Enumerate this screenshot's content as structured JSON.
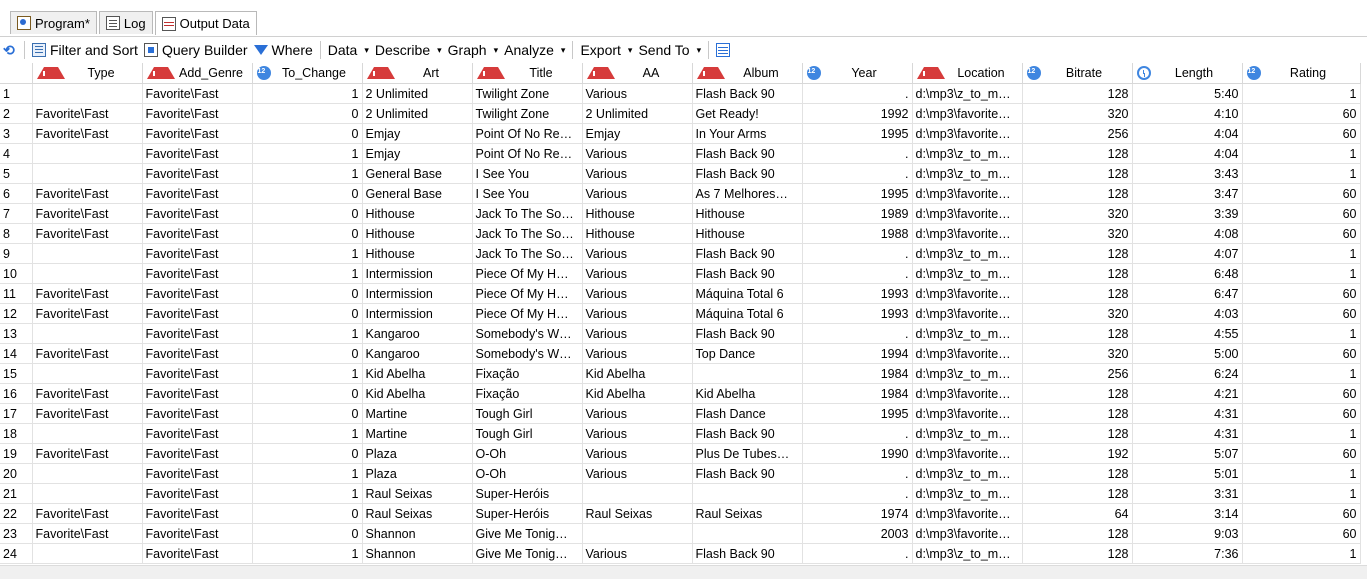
{
  "tabs": [
    {
      "label": "Program*",
      "icon": "program-icon"
    },
    {
      "label": "Log",
      "icon": "log-icon"
    },
    {
      "label": "Output Data",
      "icon": "output-data-icon"
    }
  ],
  "toolbar": {
    "filter_sort": "Filter and Sort",
    "query_builder": "Query Builder",
    "where": "Where",
    "data": "Data",
    "describe": "Describe",
    "graph": "Graph",
    "analyze": "Analyze",
    "export": "Export",
    "send_to": "Send To"
  },
  "columns": [
    {
      "name": "Type",
      "kind": "char"
    },
    {
      "name": "Add_Genre",
      "kind": "char"
    },
    {
      "name": "To_Change",
      "kind": "numeric"
    },
    {
      "name": "Art",
      "kind": "char"
    },
    {
      "name": "Title",
      "kind": "char"
    },
    {
      "name": "AA",
      "kind": "char"
    },
    {
      "name": "Album",
      "kind": "char"
    },
    {
      "name": "Year",
      "kind": "numeric"
    },
    {
      "name": "Location",
      "kind": "char"
    },
    {
      "name": "Bitrate",
      "kind": "numeric"
    },
    {
      "name": "Length",
      "kind": "time"
    },
    {
      "name": "Rating",
      "kind": "numeric"
    }
  ],
  "rows": [
    [
      "1",
      "",
      "Favorite\\Fast",
      "1",
      "2 Unlimited",
      "Twilight Zone",
      "Various",
      "Flash Back 90",
      ".",
      "d:\\mp3\\z_to_m…",
      "128",
      "5:40",
      "1"
    ],
    [
      "2",
      "Favorite\\Fast",
      "Favorite\\Fast",
      "0",
      "2 Unlimited",
      "Twilight Zone",
      "2 Unlimited",
      "Get Ready!",
      "1992",
      "d:\\mp3\\favorite…",
      "320",
      "4:10",
      "60"
    ],
    [
      "3",
      "Favorite\\Fast",
      "Favorite\\Fast",
      "0",
      "Emjay",
      "Point Of No Re…",
      "Emjay",
      "In Your Arms",
      "1995",
      "d:\\mp3\\favorite…",
      "256",
      "4:04",
      "60"
    ],
    [
      "4",
      "",
      "Favorite\\Fast",
      "1",
      "Emjay",
      "Point Of No Re…",
      "Various",
      "Flash Back 90",
      ".",
      "d:\\mp3\\z_to_m…",
      "128",
      "4:04",
      "1"
    ],
    [
      "5",
      "",
      "Favorite\\Fast",
      "1",
      "General Base",
      "I See You",
      "Various",
      "Flash Back 90",
      ".",
      "d:\\mp3\\z_to_m…",
      "128",
      "3:43",
      "1"
    ],
    [
      "6",
      "Favorite\\Fast",
      "Favorite\\Fast",
      "0",
      "General Base",
      "I See You",
      "Various",
      "As 7 Melhores…",
      "1995",
      "d:\\mp3\\favorite…",
      "128",
      "3:47",
      "60"
    ],
    [
      "7",
      "Favorite\\Fast",
      "Favorite\\Fast",
      "0",
      "Hithouse",
      "Jack To The So…",
      "Hithouse",
      "Hithouse",
      "1989",
      "d:\\mp3\\favorite…",
      "320",
      "3:39",
      "60"
    ],
    [
      "8",
      "Favorite\\Fast",
      "Favorite\\Fast",
      "0",
      "Hithouse",
      "Jack To The So…",
      "Hithouse",
      "Hithouse",
      "1988",
      "d:\\mp3\\favorite…",
      "320",
      "4:08",
      "60"
    ],
    [
      "9",
      "",
      "Favorite\\Fast",
      "1",
      "Hithouse",
      "Jack To The So…",
      "Various",
      "Flash Back 90",
      ".",
      "d:\\mp3\\z_to_m…",
      "128",
      "4:07",
      "1"
    ],
    [
      "10",
      "",
      "Favorite\\Fast",
      "1",
      "Intermission",
      "Piece Of My H…",
      "Various",
      "Flash Back 90",
      ".",
      "d:\\mp3\\z_to_m…",
      "128",
      "6:48",
      "1"
    ],
    [
      "11",
      "Favorite\\Fast",
      "Favorite\\Fast",
      "0",
      "Intermission",
      "Piece Of My H…",
      "Various",
      "Máquina Total 6",
      "1993",
      "d:\\mp3\\favorite…",
      "128",
      "6:47",
      "60"
    ],
    [
      "12",
      "Favorite\\Fast",
      "Favorite\\Fast",
      "0",
      "Intermission",
      "Piece Of My H…",
      "Various",
      "Máquina Total 6",
      "1993",
      "d:\\mp3\\favorite…",
      "320",
      "4:03",
      "60"
    ],
    [
      "13",
      "",
      "Favorite\\Fast",
      "1",
      "Kangaroo",
      "Somebody's W…",
      "Various",
      "Flash Back 90",
      ".",
      "d:\\mp3\\z_to_m…",
      "128",
      "4:55",
      "1"
    ],
    [
      "14",
      "Favorite\\Fast",
      "Favorite\\Fast",
      "0",
      "Kangaroo",
      "Somebody's W…",
      "Various",
      "Top Dance",
      "1994",
      "d:\\mp3\\favorite…",
      "320",
      "5:00",
      "60"
    ],
    [
      "15",
      "",
      "Favorite\\Fast",
      "1",
      "Kid Abelha",
      "Fixação",
      "Kid Abelha",
      "",
      "1984",
      "d:\\mp3\\z_to_m…",
      "256",
      "6:24",
      "1"
    ],
    [
      "16",
      "Favorite\\Fast",
      "Favorite\\Fast",
      "0",
      "Kid Abelha",
      "Fixação",
      "Kid Abelha",
      "Kid Abelha",
      "1984",
      "d:\\mp3\\favorite…",
      "128",
      "4:21",
      "60"
    ],
    [
      "17",
      "Favorite\\Fast",
      "Favorite\\Fast",
      "0",
      "Martine",
      "Tough Girl",
      "Various",
      "Flash Dance",
      "1995",
      "d:\\mp3\\favorite…",
      "128",
      "4:31",
      "60"
    ],
    [
      "18",
      "",
      "Favorite\\Fast",
      "1",
      "Martine",
      "Tough Girl",
      "Various",
      "Flash Back 90",
      ".",
      "d:\\mp3\\z_to_m…",
      "128",
      "4:31",
      "1"
    ],
    [
      "19",
      "Favorite\\Fast",
      "Favorite\\Fast",
      "0",
      "Plaza",
      "O-Oh",
      "Various",
      "Plus De Tubes…",
      "1990",
      "d:\\mp3\\favorite…",
      "192",
      "5:07",
      "60"
    ],
    [
      "20",
      "",
      "Favorite\\Fast",
      "1",
      "Plaza",
      "O-Oh",
      "Various",
      "Flash Back 90",
      ".",
      "d:\\mp3\\z_to_m…",
      "128",
      "5:01",
      "1"
    ],
    [
      "21",
      "",
      "Favorite\\Fast",
      "1",
      "Raul Seixas",
      "Super-Heróis",
      "",
      "",
      ".",
      "d:\\mp3\\z_to_m…",
      "128",
      "3:31",
      "1"
    ],
    [
      "22",
      "Favorite\\Fast",
      "Favorite\\Fast",
      "0",
      "Raul Seixas",
      "Super-Heróis",
      "Raul Seixas",
      "Raul Seixas",
      "1974",
      "d:\\mp3\\favorite…",
      "64",
      "3:14",
      "60"
    ],
    [
      "23",
      "Favorite\\Fast",
      "Favorite\\Fast",
      "0",
      "Shannon",
      "Give Me Tonig…",
      "",
      "",
      "2003",
      "d:\\mp3\\favorite…",
      "128",
      "9:03",
      "60"
    ],
    [
      "24",
      "",
      "Favorite\\Fast",
      "1",
      "Shannon",
      "Give Me Tonig…",
      "Various",
      "Flash Back 90",
      ".",
      "d:\\mp3\\z_to_m…",
      "128",
      "7:36",
      "1"
    ]
  ],
  "colors": {
    "char_icon": "#d63b3b",
    "numeric_icon": "#3f86e0",
    "toolbar_icon": "#2a6fd6"
  }
}
